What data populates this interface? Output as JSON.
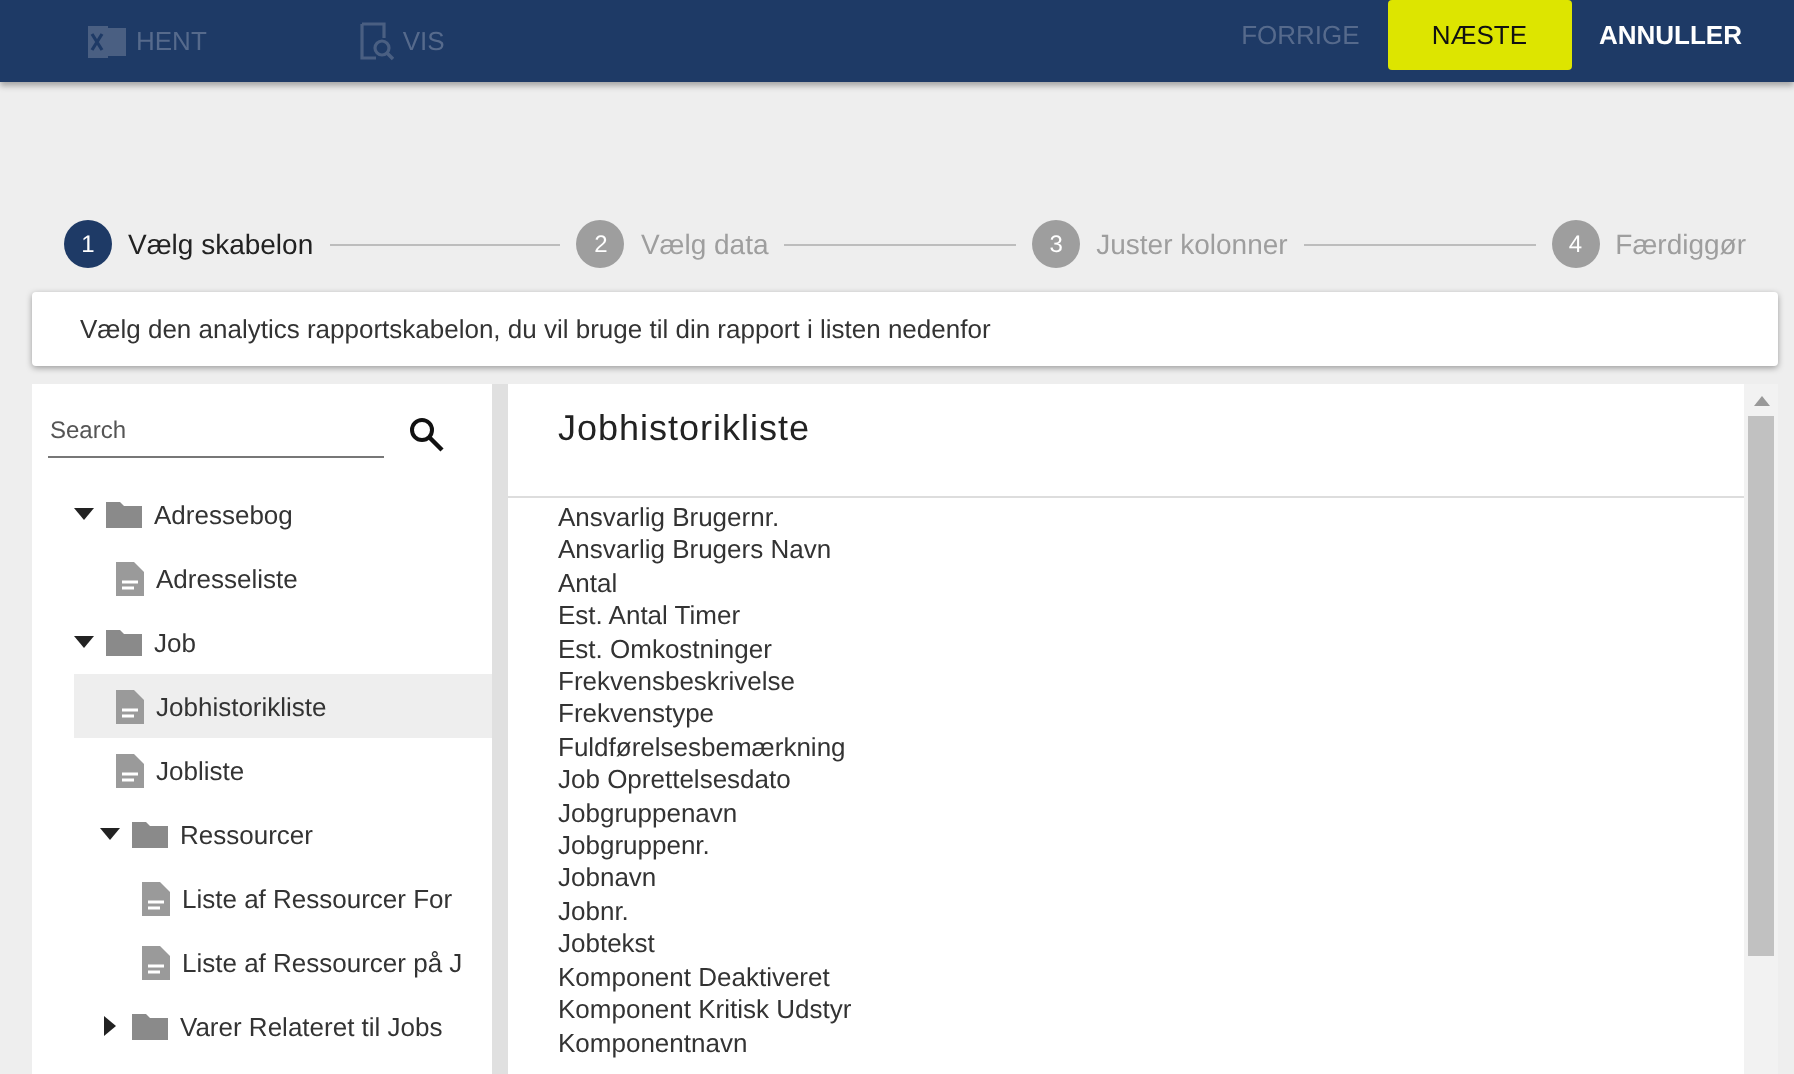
{
  "toolbar": {
    "left": [
      {
        "label": "HENT",
        "kind": "excel",
        "disabled": true
      },
      {
        "label": "VIS",
        "kind": "preview",
        "disabled": true
      }
    ],
    "right": [
      {
        "label": "FORRIGE",
        "kind": "plain",
        "disabled": true
      },
      {
        "label": "NÆSTE",
        "kind": "primary",
        "disabled": false
      },
      {
        "label": "ANNULLER",
        "kind": "plain",
        "disabled": false
      }
    ]
  },
  "steps": [
    {
      "number": "1",
      "label": "Vælg skabelon",
      "selected": true
    },
    {
      "number": "2",
      "label": "Vælg data",
      "selected": false
    },
    {
      "number": "3",
      "label": "Juster kolonner",
      "selected": false
    },
    {
      "number": "4",
      "label": "Færdiggør",
      "selected": false
    }
  ],
  "instruction": "Vælg den analytics rapportskabelon, du vil bruge til din rapport i listen nedenfor",
  "search": {
    "placeholder": "Search"
  },
  "tree": [
    {
      "label": "Adressebog",
      "kind": "folder",
      "expanded": true,
      "children": [
        {
          "label": "Adresseliste",
          "kind": "report",
          "selected": false
        }
      ]
    },
    {
      "label": "Job",
      "kind": "folder",
      "expanded": true,
      "children": [
        {
          "label": "Jobhistorikliste",
          "kind": "report",
          "selected": true
        },
        {
          "label": "Jobliste",
          "kind": "report",
          "selected": false
        },
        {
          "label": "Ressourcer",
          "kind": "folder",
          "expanded": true,
          "children": [
            {
              "label": "Liste af Ressourcer For",
              "kind": "report",
              "selected": false
            },
            {
              "label": "Liste af Ressourcer på J",
              "kind": "report",
              "selected": false
            }
          ]
        },
        {
          "label": "Varer Relateret til Jobs",
          "kind": "folder",
          "expanded": false
        }
      ]
    }
  ],
  "detail": {
    "title": "Jobhistorikliste",
    "fields": [
      "Ansvarlig Brugernr.",
      "Ansvarlig Brugers Navn",
      "Antal",
      "Est. Antal Timer",
      "Est. Omkostninger",
      "Frekvensbeskrivelse",
      "Frekvenstype",
      "Fuldførelsesbemærkning",
      "Job Oprettelsesdato",
      "Jobgruppenavn",
      "Jobgruppenr.",
      "Jobnavn",
      "Jobnr.",
      "Jobtekst",
      "Komponent Deaktiveret",
      "Komponent Kritisk Udstyr",
      "Komponentnavn"
    ]
  }
}
